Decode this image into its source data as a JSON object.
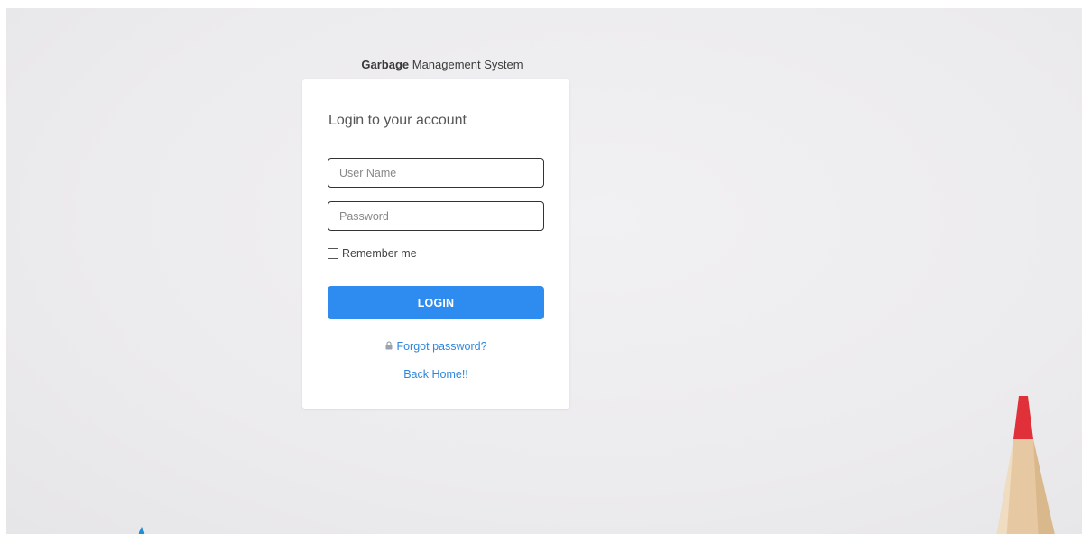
{
  "header": {
    "brand_bold": "Garbage",
    "brand_rest": " Management System"
  },
  "login_card": {
    "title": "Login to your account",
    "username_placeholder": "User Name",
    "password_placeholder": "Password",
    "remember_label": "Remember me",
    "login_label": "LOGIN",
    "forgot_label": "Forgot password?",
    "back_home_label": "Back Home!!"
  },
  "icons": {
    "forgot": "lock-icon",
    "remember": "checkbox-icon"
  },
  "colors": {
    "primary_button": "#2e8cf0",
    "link": "#2e86de",
    "background": "#ecebed",
    "card": "#ffffff"
  }
}
